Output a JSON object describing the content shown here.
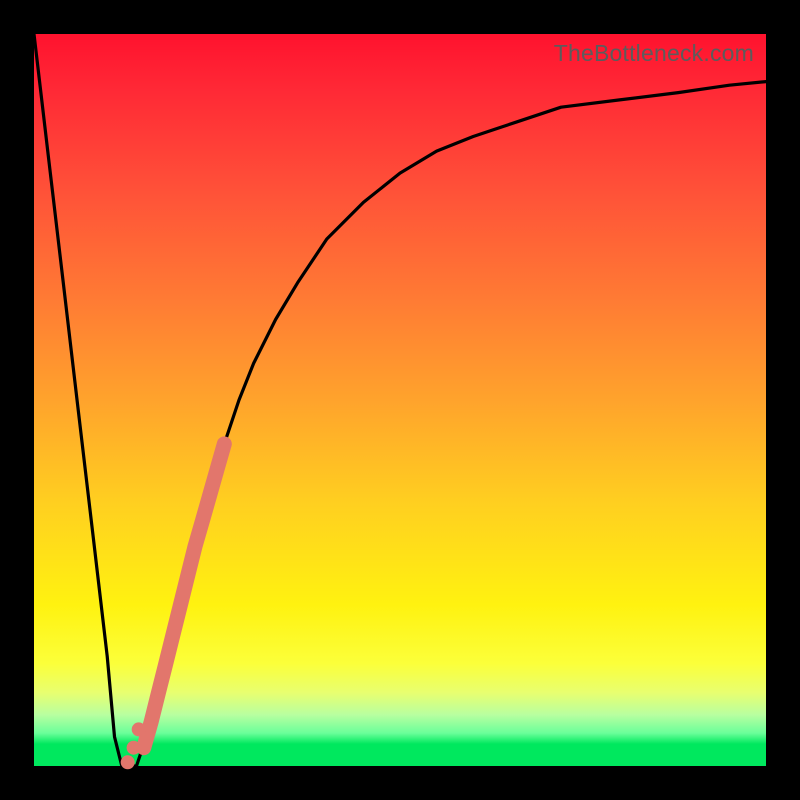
{
  "watermark": "TheBottleneck.com",
  "chart_data": {
    "type": "line",
    "title": "",
    "xlabel": "",
    "ylabel": "",
    "xlim": [
      0,
      100
    ],
    "ylim": [
      0,
      100
    ],
    "series": [
      {
        "name": "curve",
        "x": [
          0,
          2,
          4,
          6,
          8,
          10,
          11,
          12,
          14,
          16,
          18,
          20,
          22,
          24,
          26,
          28,
          30,
          33,
          36,
          40,
          45,
          50,
          55,
          60,
          66,
          72,
          80,
          88,
          95,
          100
        ],
        "y": [
          100,
          83,
          66,
          49,
          32,
          15,
          4,
          0,
          0,
          6,
          14,
          22,
          30,
          37,
          44,
          50,
          55,
          61,
          66,
          72,
          77,
          81,
          84,
          86,
          88,
          90,
          91,
          92,
          93,
          93.5
        ]
      }
    ],
    "highlight_segment": {
      "name": "salmon-stroke",
      "color": "#e2766c",
      "x": [
        15.0,
        16.0,
        17.0,
        18.0,
        19.0,
        20.0,
        21.0,
        22.0,
        23.0,
        24.0,
        25.0,
        26.0
      ],
      "y": [
        2.5,
        6.0,
        10.0,
        14.0,
        18.0,
        22.0,
        26.0,
        30.0,
        33.5,
        37.0,
        40.5,
        44.0
      ]
    },
    "highlight_dots": {
      "name": "salmon-dots",
      "color": "#e2766c",
      "points": [
        {
          "x": 12.8,
          "y": 0.5
        },
        {
          "x": 13.6,
          "y": 2.5
        },
        {
          "x": 14.3,
          "y": 5.0
        }
      ]
    }
  }
}
